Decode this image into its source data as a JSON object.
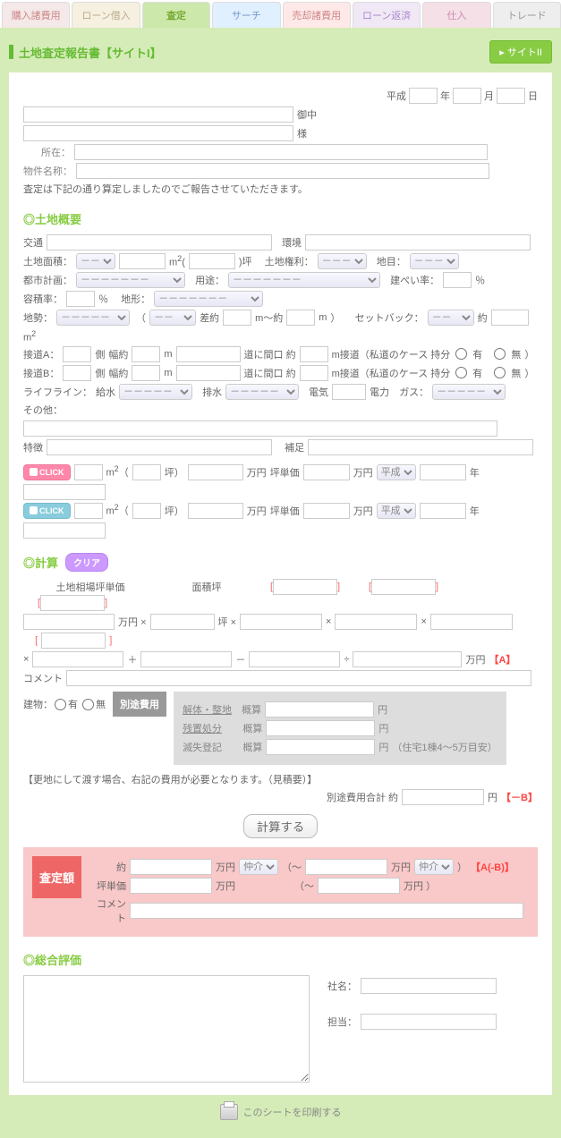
{
  "tabs": [
    "購入諸費用",
    "ローン借入",
    "査定",
    "サーチ",
    "売却諸費用",
    "ローン返済",
    "仕入",
    "トレード"
  ],
  "hdr": {
    "title": "土地査定報告書【サイトI】",
    "site_btn": "▸ サイトII"
  },
  "date": {
    "era": "平成",
    "y": "年",
    "m": "月",
    "d": "日"
  },
  "addr": {
    "onchu": "御中",
    "sama": "様",
    "loc": "所在：",
    "prop": "物件名称：",
    "note": "査定は下記の通り算定しましたのでご報告させていただきます。"
  },
  "s1": {
    "title": "◎土地概要",
    "traffic": "交通",
    "env": "環境",
    "area": "土地面積：",
    "m2": "m",
    "tsubo": "坪",
    "right": "土地権利：",
    "moku": "地目：",
    "plan": "都市計画：",
    "use": "用途：",
    "kenpei": "建ぺい率：",
    "pct": "％",
    "yoseki": "容積率：",
    "shape": "地形：",
    "sei": "地勢：",
    "sa": "差約",
    "m_unit": "m",
    "tilde": "～約",
    "setback": "セットバック：",
    "yaku": "約",
    "roadA": "接道A：",
    "roadB": "接道B：",
    "side": "側",
    "width": "幅約",
    "front": "道に間口 約",
    "conn": "m接道（私道のケース 持分",
    "yes": "有",
    "no": "無",
    "life": "ライフライン：",
    "water": "給水",
    "drain": "排水",
    "elec": "電気",
    "elec2": "電力",
    "gas": "ガス：",
    "other": "その他：",
    "feat": "特徴",
    "supp": "補足",
    "click": "CLICK",
    "man": "万円",
    "unit": "坪単価",
    "era": "平成",
    "yr": "年",
    "dash": "－－",
    "dash3": "－－－",
    "dash7": "－－－－－－－",
    "dash5": "－－－－－"
  },
  "s2": {
    "title": "◎計算",
    "clear": "クリア",
    "souba": "土地相場坪単価",
    "mtsubo": "面積坪",
    "man": "万円",
    "tsubo": "坪",
    "x": "×",
    "plus": "＋",
    "minus": "－",
    "div": "÷",
    "A": "【A】",
    "comment": "コメント",
    "bld": "建物：",
    "yes": "有",
    "no": "無",
    "extra": "別途費用",
    "kai": "解体・整地",
    "zan": "残置処分",
    "mes": "滅失登記",
    "gai": "概算",
    "en": "円",
    "house": "（住宅1棟4～5万目安）",
    "note": "【更地にして渡す場合、右記の費用が必要となります。（見積要）】",
    "total": "別途費用合計 約",
    "minusB": "【－B】",
    "calc": "計算する"
  },
  "s3": {
    "label": "査定額",
    "yaku": "約",
    "man": "万円",
    "chukai": "仲介",
    "tilde": "（～",
    "close": "）",
    "AB": "【A(-B)】",
    "tsubo": "坪単価",
    "comment": "コメント"
  },
  "s4": {
    "title": "◎総合評価",
    "comp": "社名：",
    "person": "担当："
  },
  "print": "このシートを印刷する"
}
